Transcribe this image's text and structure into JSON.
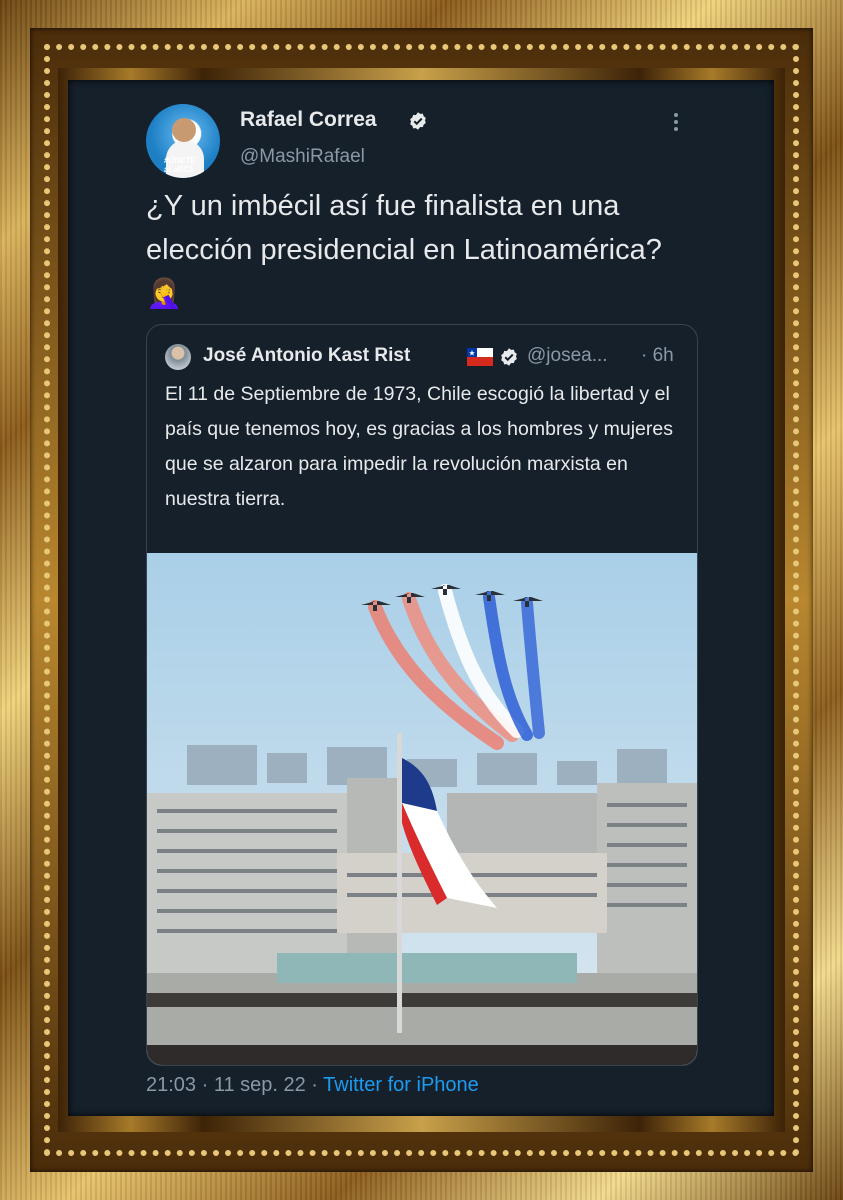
{
  "tweet": {
    "author_name": "Rafael Correa",
    "author_handle": "@MashiRafael",
    "avatar_text": "#ÚNETE aLaRC5",
    "text": "¿Y un imbécil así fue finalista en una elección presidencial en Latinoamérica? 🤦‍♀️",
    "timestamp": "21:03 · 11 sep. 22 · ",
    "source": "Twitter for iPhone"
  },
  "quoted_tweet": {
    "author_name": "José Antonio Kast Rist",
    "author_handle": "@josea...",
    "time": "· 6h",
    "text": "El 11 de Septiembre de 1973, Chile escogió la libertad y el país que tenemos hoy, es gracias a los hombres y mujeres que se alzaron para impedir la revolución marxista en nuestra tierra."
  },
  "colors": {
    "background": "#15202b",
    "primary_text": "#e7e9ea",
    "secondary_text": "#8b98a5",
    "link": "#1d9bf0",
    "verified": "#e7e9ea"
  },
  "icons": [
    "verified-badge-icon",
    "more-options-icon",
    "chile-flag-icon"
  ]
}
